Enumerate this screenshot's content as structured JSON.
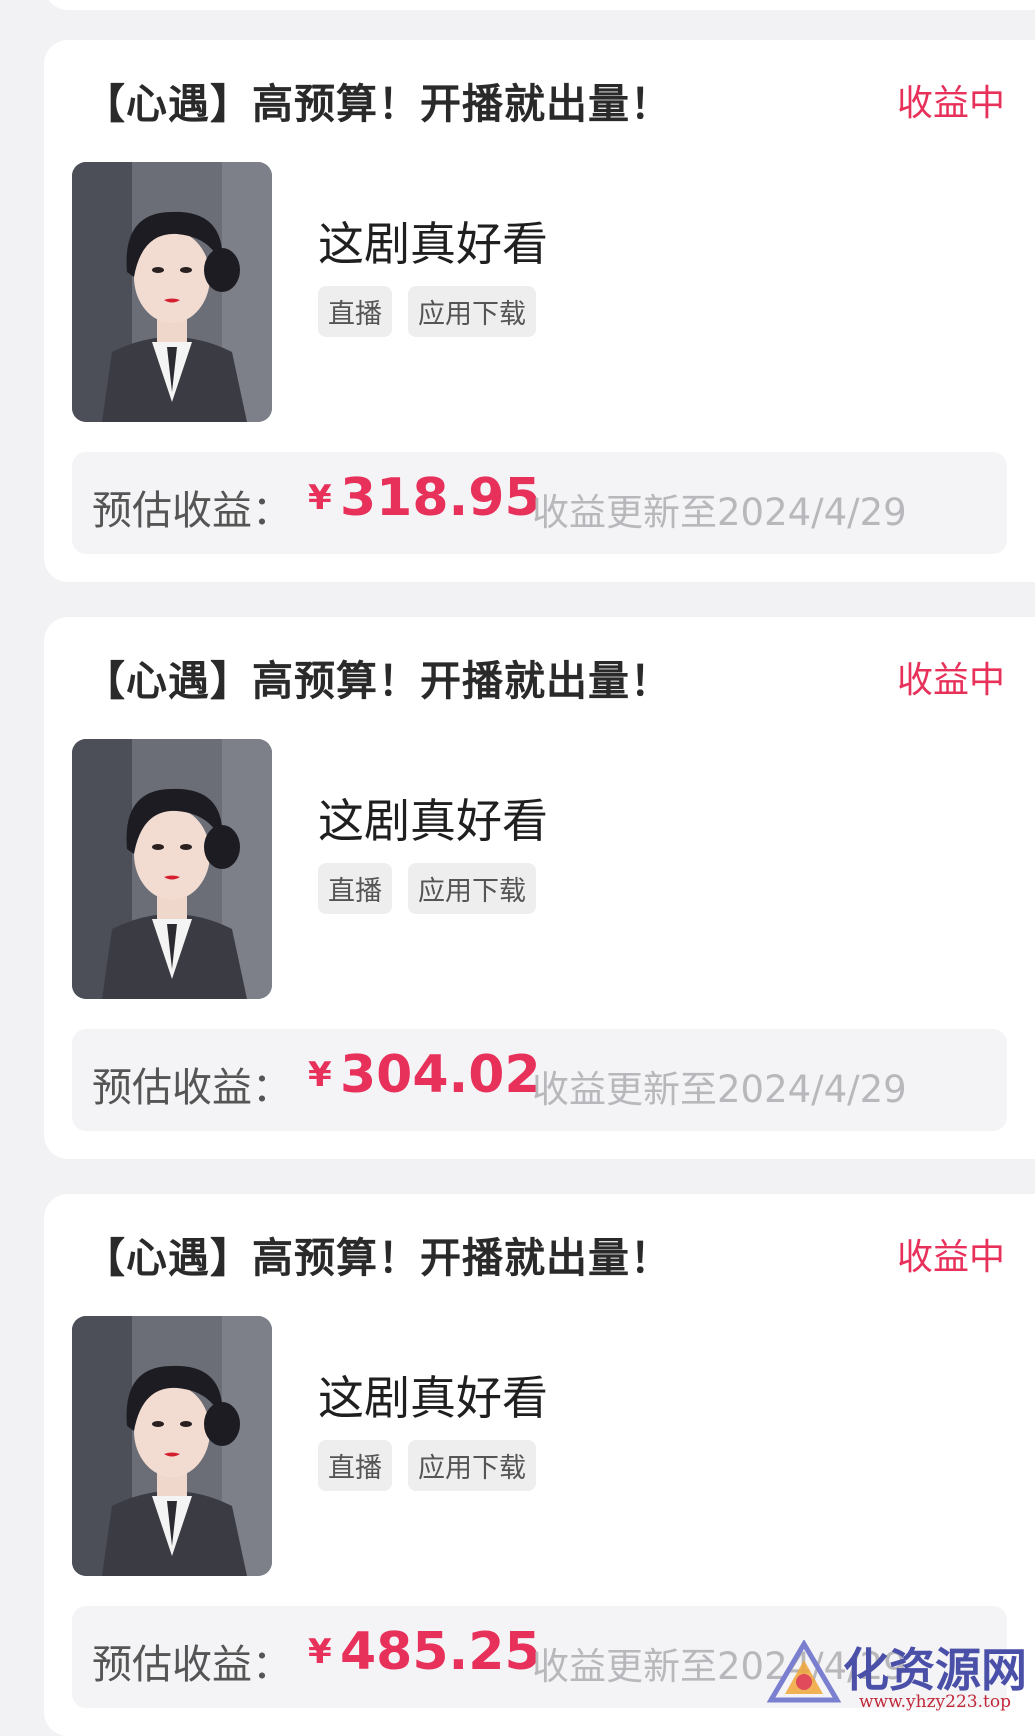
{
  "cards": [
    {
      "title": "【心遇】高预算！开播就出量！",
      "status": "收益中",
      "drama_name": "这剧真好看",
      "tags": [
        "直播",
        "应用下载"
      ],
      "earnings_label": "预估收益：",
      "currency": "¥",
      "amount": "318.95",
      "update_note": "收益更新至2024/4/29"
    },
    {
      "title": "【心遇】高预算！开播就出量！",
      "status": "收益中",
      "drama_name": "这剧真好看",
      "tags": [
        "直播",
        "应用下载"
      ],
      "earnings_label": "预估收益：",
      "currency": "¥",
      "amount": "304.02",
      "update_note": "收益更新至2024/4/29"
    },
    {
      "title": "【心遇】高预算！开播就出量！",
      "status": "收益中",
      "drama_name": "这剧真好看",
      "tags": [
        "直播",
        "应用下载"
      ],
      "earnings_label": "预估收益：",
      "currency": "¥",
      "amount": "485.25",
      "update_note": "收益更新至2024/4/29"
    }
  ],
  "watermark": {
    "name": "化资源网",
    "url": "www.yhzy223.top"
  },
  "colors": {
    "accent": "#e8315a",
    "background": "#f2f2f4",
    "card": "#ffffff"
  }
}
